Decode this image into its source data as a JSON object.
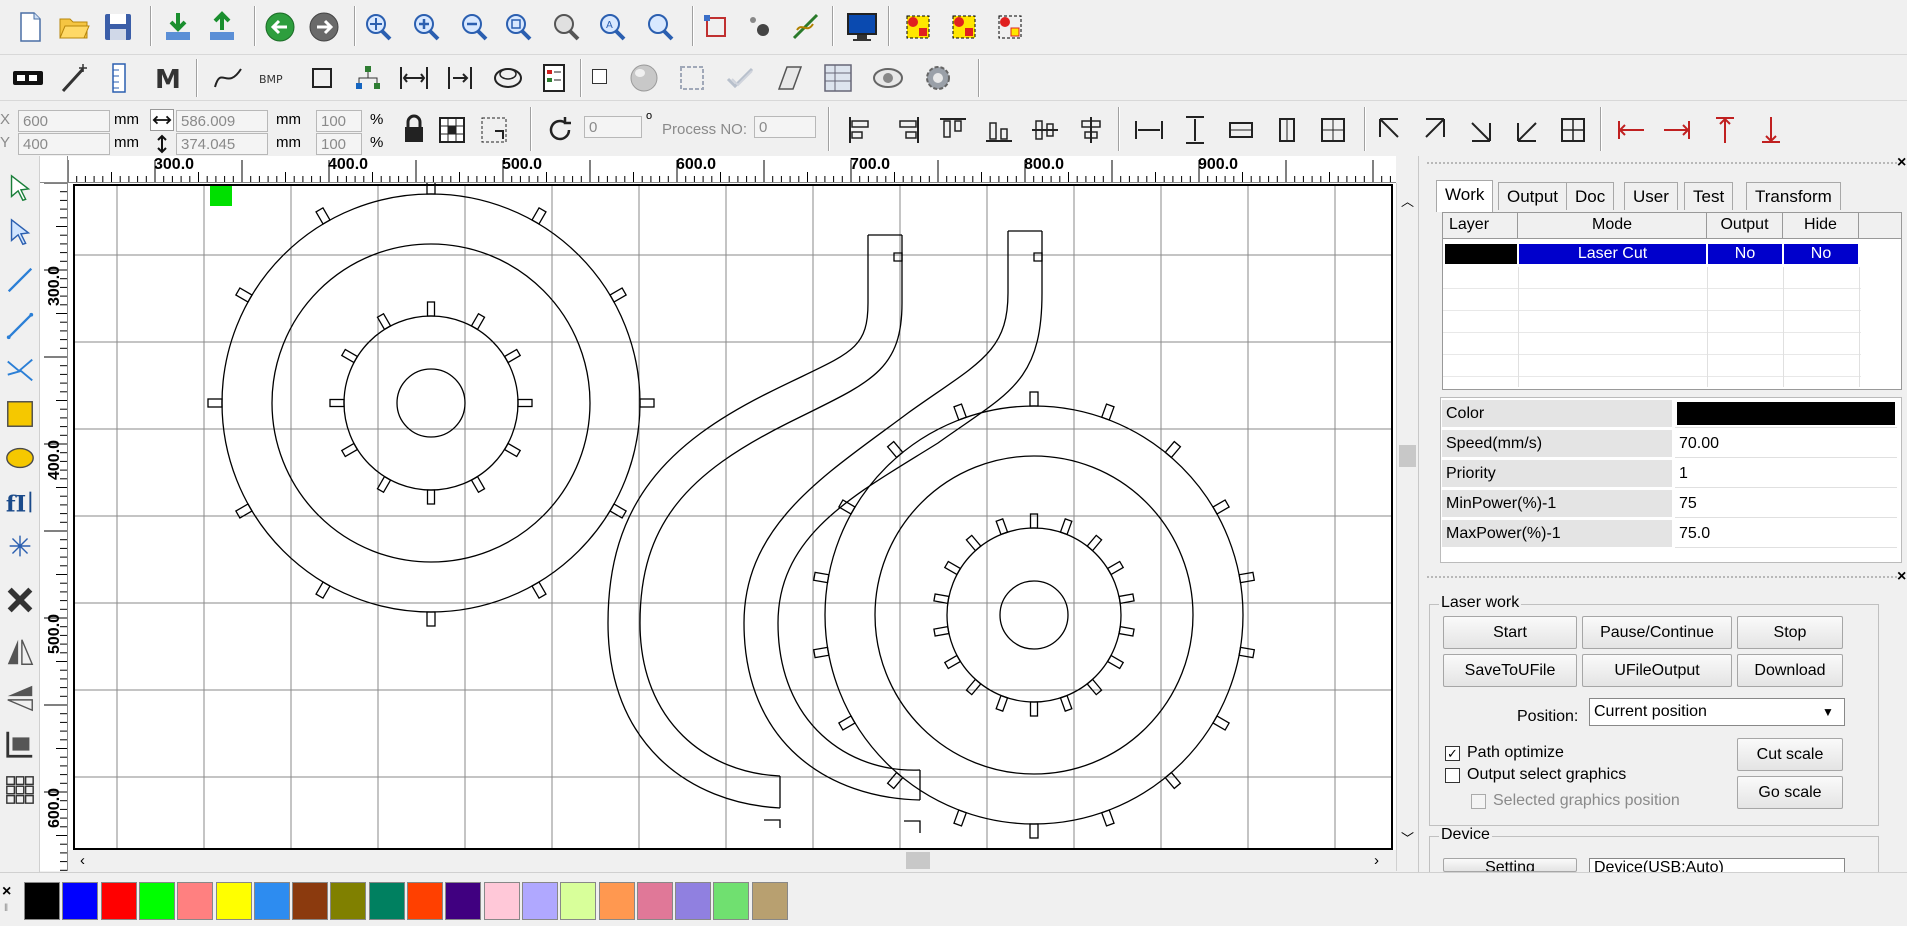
{
  "coords": {
    "x_label": "X",
    "y_label": "Y",
    "x_value": "600",
    "y_value": "400",
    "unit_mm": "mm",
    "width_value": "586.009",
    "height_value": "374.045",
    "scale_w": "100",
    "scale_h": "100",
    "percent": "%",
    "rotate_value": "0",
    "degree": "o",
    "process_no_label": "Process NO:",
    "process_no_value": "0"
  },
  "ruler": {
    "top_ticks": [
      "300.0",
      "400.0",
      "500.0",
      "600.0",
      "700.0",
      "800.0",
      "900.0"
    ],
    "left_ticks": [
      "300.0",
      "400.0",
      "500.0",
      "600.0"
    ]
  },
  "panel": {
    "tabs": [
      "Work",
      "Output",
      "Doc",
      "User",
      "Test",
      "Transform"
    ],
    "active_tab": "Work",
    "layer_table": {
      "headers": [
        "Layer",
        "Mode",
        "Output",
        "Hide"
      ],
      "rows": [
        {
          "color": "#000000",
          "mode": "Laser Cut",
          "output": "No",
          "hide": "No"
        }
      ]
    },
    "props": [
      {
        "key": "Color",
        "value": ""
      },
      {
        "key": "Speed(mm/s)",
        "value": "70.00"
      },
      {
        "key": "Priority",
        "value": "1"
      },
      {
        "key": "MinPower(%)-1",
        "value": "75"
      },
      {
        "key": "MaxPower(%)-1",
        "value": "75.0"
      }
    ],
    "laser_work": {
      "group_label": "Laser work",
      "start": "Start",
      "pause": "Pause/Continue",
      "stop": "Stop",
      "save_ufile": "SaveToUFile",
      "ufile_output": "UFileOutput",
      "download": "Download",
      "position_label": "Position:",
      "position_value": "Current position",
      "path_optimize": "Path optimize",
      "output_select": "Output select graphics",
      "selected_position": "Selected graphics position",
      "cut_scale": "Cut scale",
      "go_scale": "Go scale"
    },
    "device": {
      "group_label": "Device",
      "setting": "Setting",
      "device_value": "Device(USB:Auto)"
    }
  },
  "palette": [
    "#000000",
    "#0000ff",
    "#ff0000",
    "#00ff00",
    "#ff8080",
    "#ffff00",
    "#2d8cf0",
    "#8b3a0e",
    "#808000",
    "#008060",
    "#ff4000",
    "#400080",
    "#ffc8d8",
    "#b0a8ff",
    "#d8ff9a",
    "#ff9850",
    "#e07898",
    "#9080e0",
    "#70e070",
    "#b8a070"
  ],
  "close_x": "×"
}
